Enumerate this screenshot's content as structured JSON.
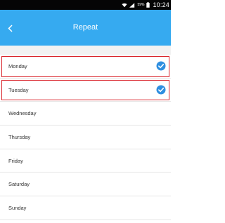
{
  "status_bar": {
    "time": "10:24",
    "battery_text": "59%"
  },
  "header": {
    "title": "Repeat",
    "back_icon": "chevron-left-icon"
  },
  "colors": {
    "accent": "#36aaf0",
    "highlight_border": "#d9232a",
    "check": "#2f8fe0"
  },
  "days": [
    {
      "label": "Monday",
      "checked": true,
      "highlighted": true
    },
    {
      "label": "Tuesday",
      "checked": true,
      "highlighted": true
    },
    {
      "label": "Wednesday",
      "checked": false,
      "highlighted": false
    },
    {
      "label": "Thursday",
      "checked": false,
      "highlighted": false
    },
    {
      "label": "Friday",
      "checked": false,
      "highlighted": false
    },
    {
      "label": "Saturday",
      "checked": false,
      "highlighted": false
    },
    {
      "label": "Sunday",
      "checked": false,
      "highlighted": false
    }
  ]
}
